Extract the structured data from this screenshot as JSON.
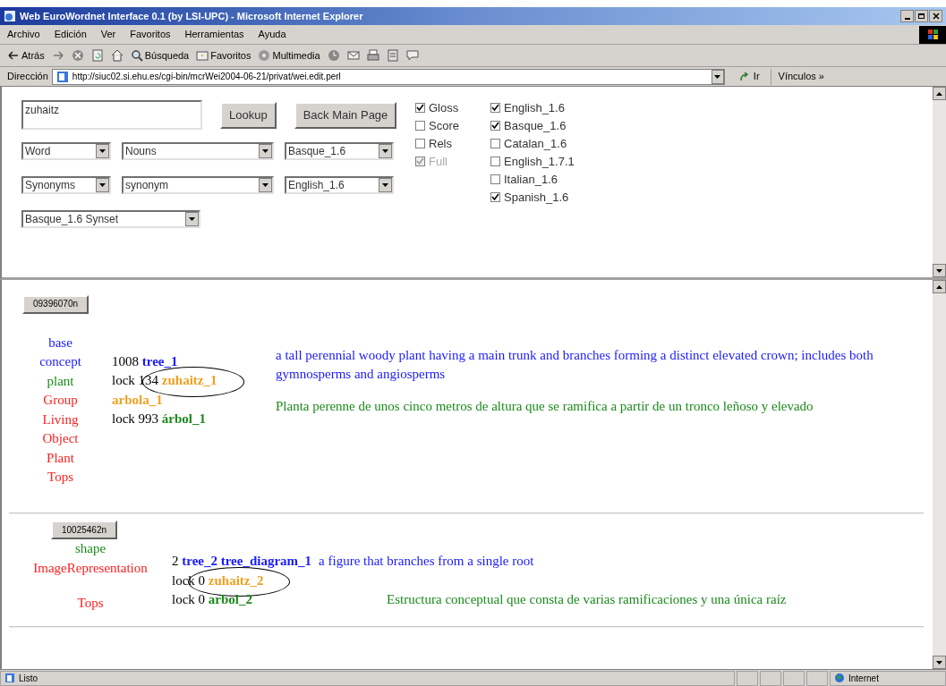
{
  "window": {
    "title": "Web EuroWordnet Interface 0.1 (by LSI-UPC) - Microsoft Internet Explorer"
  },
  "menu": [
    "Archivo",
    "Edición",
    "Ver",
    "Favoritos",
    "Herramientas",
    "Ayuda"
  ],
  "toolbar": [
    {
      "kind": "back",
      "label": "Atrás"
    },
    {
      "kind": "forward"
    },
    {
      "kind": "stop"
    },
    {
      "kind": "refresh"
    },
    {
      "kind": "home"
    },
    {
      "kind": "search",
      "label": "Búsqueda"
    },
    {
      "kind": "favorites",
      "label": "Favoritos"
    },
    {
      "kind": "media",
      "label": "Multimedia"
    },
    {
      "kind": "history"
    },
    {
      "kind": "mail"
    },
    {
      "kind": "print"
    },
    {
      "kind": "edit"
    },
    {
      "kind": "discuss"
    }
  ],
  "address_bar": {
    "label": "Dirección",
    "url": "http://siuc02.si.ehu.es/cgi-bin/mcrWei2004-06-21/privat/wei.edit.perl",
    "go": "Ir",
    "links": "Vínculos »"
  },
  "form": {
    "query": "zuhaitz",
    "buttons": [
      "Lookup",
      "Back Main Page"
    ],
    "select_rows": [
      [
        "Word",
        "Nouns",
        "Basque_1.6"
      ],
      [
        "Synonyms",
        "synonym",
        "English_1.6"
      ],
      [
        "Basque_1.6 Synset"
      ]
    ],
    "options": [
      {
        "label": "Gloss",
        "checked": true,
        "disabled": false
      },
      {
        "label": "Score",
        "checked": false,
        "disabled": false
      },
      {
        "label": "Rels",
        "checked": false,
        "disabled": false
      },
      {
        "label": "Full",
        "checked": true,
        "disabled": true
      }
    ],
    "languages": [
      {
        "label": "English_1.6",
        "checked": true
      },
      {
        "label": "Basque_1.6",
        "checked": true
      },
      {
        "label": "Catalan_1.6",
        "checked": false
      },
      {
        "label": "English_1.7.1",
        "checked": false
      },
      {
        "label": "Italian_1.6",
        "checked": false
      },
      {
        "label": "Spanish_1.6",
        "checked": true
      }
    ]
  },
  "synsets": [
    {
      "kind": "stacked",
      "id": "09396070n",
      "labels": [
        {
          "text": "base",
          "color": "#1a1aff"
        },
        {
          "text": "concept",
          "color": "#1a1aff"
        },
        {
          "text": "plant",
          "color": "#1a8a1a"
        },
        {
          "text": "Group",
          "color": "#ff2020"
        },
        {
          "text": "Living",
          "color": "#ff2020"
        },
        {
          "text": "Object",
          "color": "#ff2020"
        },
        {
          "text": "Plant",
          "color": "#ff2020"
        },
        {
          "text": "Tops",
          "color": "#ff2020"
        }
      ],
      "lines": [
        {
          "prefix": "1008",
          "words": "tree_1",
          "color": "#1a1aff",
          "circled": false
        },
        {
          "prefix": "lock 134",
          "words": "zuhaitz_1",
          "color": "#f0a020",
          "circled": true
        },
        {
          "words": "arbola_1",
          "color": "#f0a020",
          "circled": false
        },
        {
          "prefix": "lock 993",
          "words": "árbol_1",
          "color": "#1a8a1a",
          "circled": false
        }
      ],
      "glosses": [
        {
          "text": "a tall perennial woody plant having a main trunk and branches forming a distinct elevated crown; includes both gymnosperms and angiosperms",
          "color": "#1a1aff"
        },
        {
          "text": "Planta perenne de unos cinco metros de altura que se ramifica a partir de un tronco leñoso y elevado",
          "color": "#1a8a1a"
        }
      ]
    },
    {
      "kind": "inline",
      "id": "10025462n",
      "labels": [
        {
          "text": "shape",
          "color": "#1a8a1a"
        },
        {
          "text": "ImageRepresentation",
          "color": "#ff2020"
        },
        {
          "text": "Tops",
          "color": "#ff2020"
        }
      ],
      "lines": [
        {
          "prefix": "2",
          "words": "tree_2 tree_diagram_1",
          "color": "#1a1aff",
          "circled": false,
          "gloss": {
            "text": "a figure that branches from a single root",
            "color": "#1a1aff"
          }
        },
        {
          "prefix": "lock 0",
          "words": "zuhaitz_2",
          "color": "#f0a020",
          "circled": true
        },
        {
          "prefix": "lock 0",
          "words": "arbol_2",
          "color": "#1a8a1a",
          "circled": false,
          "gloss": {
            "text": "Estructura conceptual que consta de varias ramificaciones y una única raíz",
            "color": "#1a8a1a"
          }
        }
      ]
    }
  ],
  "status_bar": {
    "text": "Listo",
    "zone": "Internet"
  }
}
